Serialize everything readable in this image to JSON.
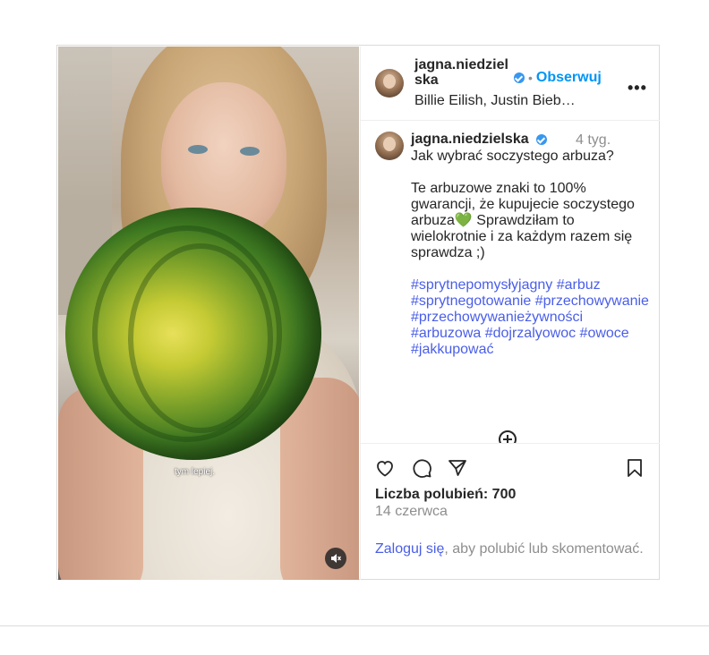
{
  "post": {
    "video": {
      "caption_overlay": "tym lepiej.",
      "mute_icon": "speaker-muted-icon"
    },
    "header": {
      "username": "jagna.niedzielska",
      "verified": true,
      "dot": "•",
      "follow_label": "Obserwuj",
      "audio": "Billie Eilish, Justin Bieb…",
      "more_label": "•••"
    },
    "comment": {
      "username": "jagna.niedzielska",
      "time": "4 tyg.",
      "text": "Jak wybrać soczystego arbuza?\n\nTe arbuzowe znaki to 100% gwarancji, że kupujecie soczystego arbuza💚 Sprawdziłam to wielokrotnie i za każdym razem się sprawdza ;)",
      "hashtags": "#sprytnepomysłyjagny #arbuz #sprytnegotowanie #przechowywanie #przechowywanieżywności #arbuzowa #dojrzalyowoc #owoce #jakkupować"
    },
    "actions": {
      "likes": "Liczba polubień: 700",
      "date": "14 czerwca",
      "login_link": "Zaloguj się",
      "login_rest": ", aby polubić lub skomentować."
    }
  },
  "colors": {
    "link": "#4a5ee8",
    "follow": "#0095f6",
    "muted": "#8e8e8e",
    "border": "#dbdbdb"
  }
}
